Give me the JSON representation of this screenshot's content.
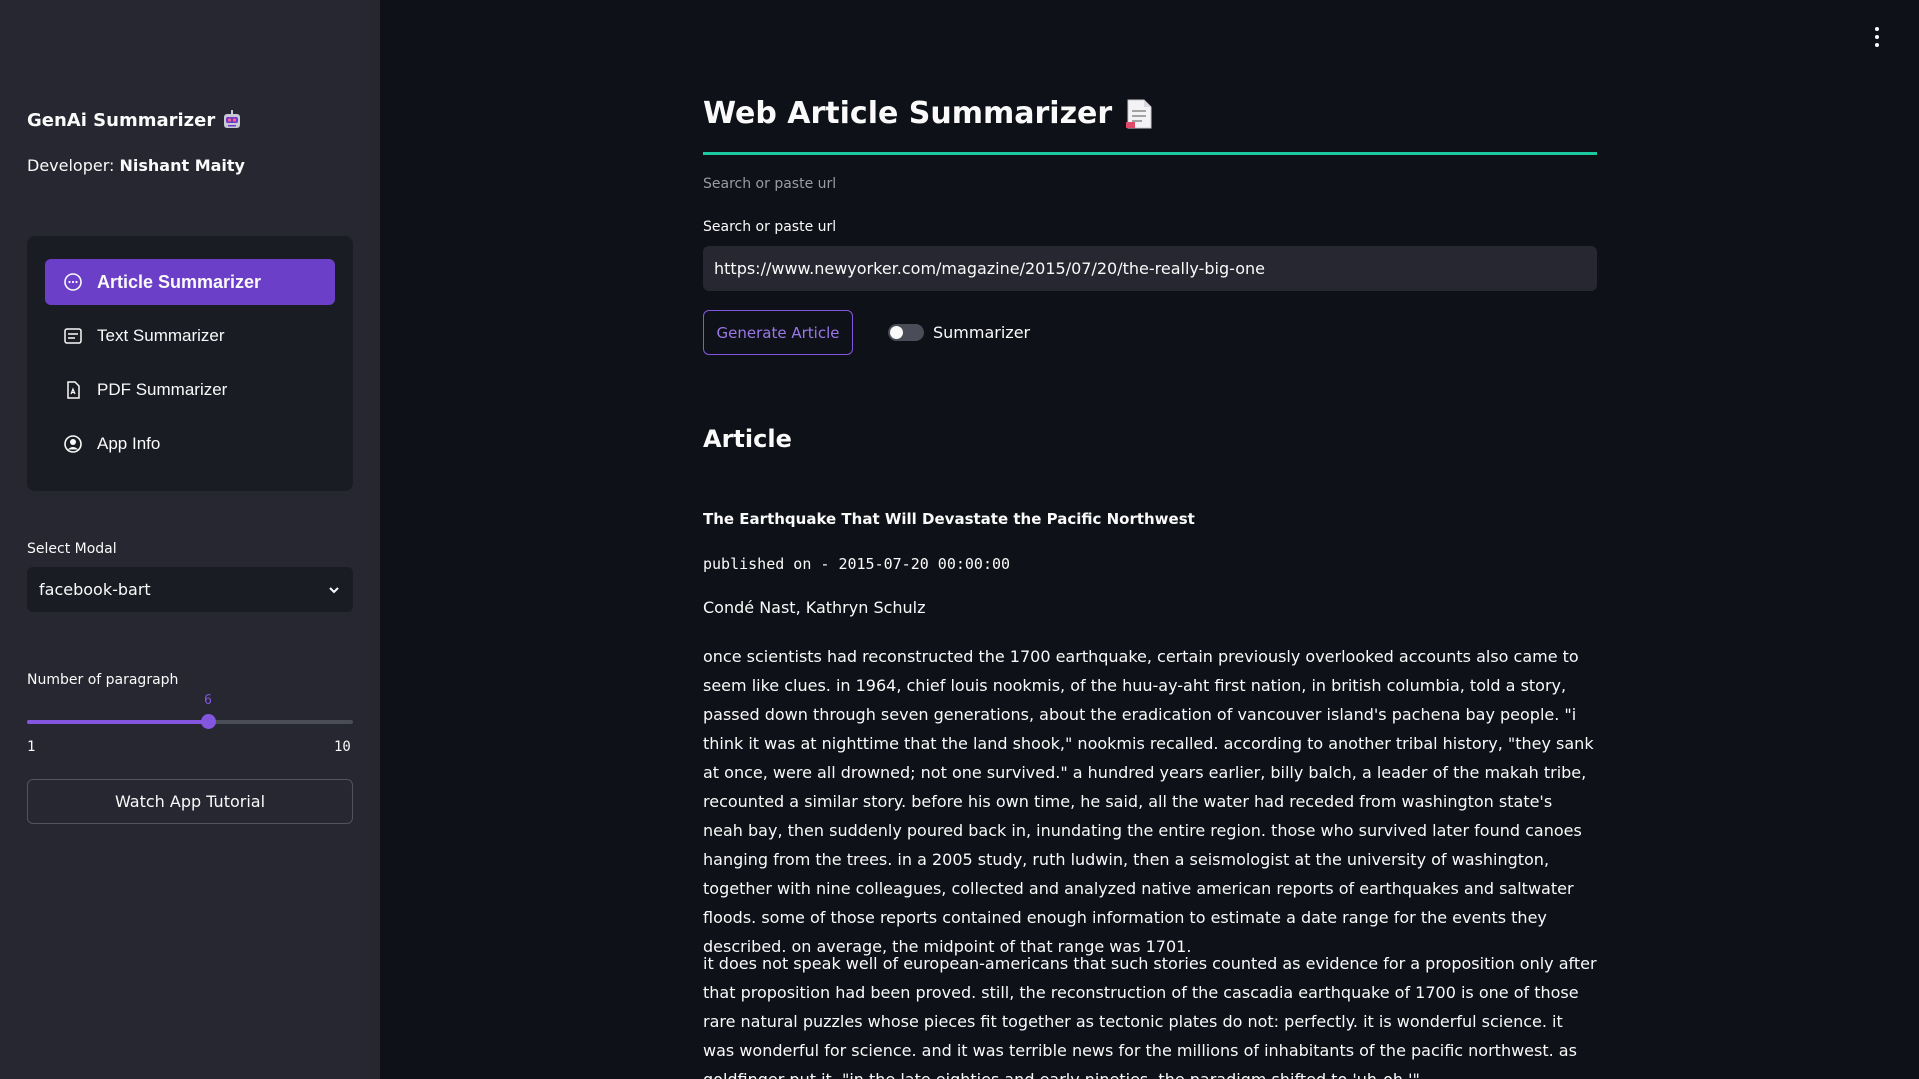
{
  "sidebar": {
    "brand": "GenAi Summarizer",
    "developer_label": "Developer:",
    "developer_name": "Nishant Maity",
    "menu": [
      {
        "label": "Article Summarizer",
        "icon": "chat-icon",
        "active": true
      },
      {
        "label": "Text Summarizer",
        "icon": "text-lines-icon",
        "active": false
      },
      {
        "label": "PDF Summarizer",
        "icon": "pdf-file-icon",
        "active": false
      },
      {
        "label": "App Info",
        "icon": "user-circle-icon",
        "active": false
      }
    ],
    "select_label": "Select Modal",
    "select_value": "facebook-bart",
    "slider": {
      "label": "Number of paragraph",
      "value": 6,
      "min": 1,
      "max": 10,
      "value_text": "6",
      "min_text": "1",
      "max_text": "10"
    },
    "tutorial_button": "Watch App Tutorial"
  },
  "main": {
    "title": "Web Article Summarizer",
    "hint": "Search or paste url",
    "input_label": "Search or paste url",
    "url_value": "https://www.newyorker.com/magazine/2015/07/20/the-really-big-one",
    "generate_button": "Generate Article",
    "toggle_label": "Summarizer",
    "toggle_on": false,
    "section_heading": "Article",
    "article_title": "The Earthquake That Will Devastate the Pacific Northwest",
    "published": "published on - 2015-07-20 00:00:00",
    "authors": "Condé Nast, Kathryn Schulz",
    "paragraphs": [
      "once scientists had reconstructed the 1700 earthquake, certain previously overlooked accounts also came to seem like clues. in 1964, chief louis nookmis, of the huu-ay-aht first nation, in british columbia, told a story, passed down through seven generations, about the eradication of vancouver island's pachena bay people. \"i think it was at nighttime that the land shook,\" nookmis recalled. according to another tribal history, \"they sank at once, were all drowned; not one survived.\" a hundred years earlier, billy balch, a leader of the makah tribe, recounted a similar story. before his own time, he said, all the water had receded from washington state's neah bay, then suddenly poured back in, inundating the entire region. those who survived later found canoes hanging from the trees. in a 2005 study, ruth ludwin, then a seismologist at the university of washington, together with nine colleagues, collected and analyzed native american reports of earthquakes and saltwater floods. some of those reports contained enough information to estimate a date range for the events they described. on average, the midpoint of that range was 1701.",
      "it does not speak well of european-americans that such stories counted as evidence for a proposition only after that proposition had been proved. still, the reconstruction of the cascadia earthquake of 1700 is one of those rare natural puzzles whose pieces fit together as tectonic plates do not: perfectly. it is wonderful science. it was wonderful for science. and it was terrible news for the millions of inhabitants of the pacific northwest. as goldfinger put it, \"in the late eighties and early nineties, the paradigm shifted to 'uh-oh.'\""
    ]
  },
  "colors": {
    "accent": "#6c3fc8",
    "slider": "#8456e0",
    "rule": "#1bc9a0",
    "sidebar_bg": "#262730",
    "main_bg": "#0e1117"
  }
}
